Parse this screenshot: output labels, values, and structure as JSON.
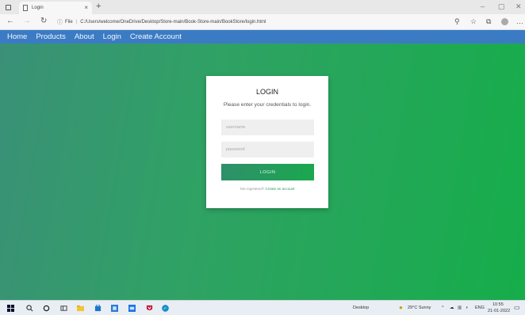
{
  "browser": {
    "tab_title": "Login",
    "tab_close": "×",
    "new_tab": "+",
    "address_prefix": "File",
    "address_url": "C:/Users/welcome/OneDrive/Desktop/Store-main/Book-Store-main/BookStore/login.html",
    "controls": {
      "minimize": "–",
      "maximize": "▢",
      "close": "✕"
    }
  },
  "navbar": {
    "items": [
      {
        "label": "Home"
      },
      {
        "label": "Products"
      },
      {
        "label": "About"
      },
      {
        "label": "Login"
      },
      {
        "label": "Create Account"
      }
    ]
  },
  "login": {
    "title": "LOGIN",
    "subtitle": "Please enter your credentials to login.",
    "username_placeholder": "username",
    "password_placeholder": "password",
    "button_label": "LOGIN",
    "register_prompt": "Not registered?",
    "register_link": "Create an account"
  },
  "taskbar": {
    "desktop_label": "Desktop",
    "weather": "29°C Sunny",
    "language": "ENG",
    "time": "10:55",
    "date": "21-01-2022"
  },
  "colors": {
    "navbar": "#3b7bc4",
    "gradient_start": "#3a9077",
    "gradient_end": "#16ad4a",
    "button": "#1aa84e"
  }
}
